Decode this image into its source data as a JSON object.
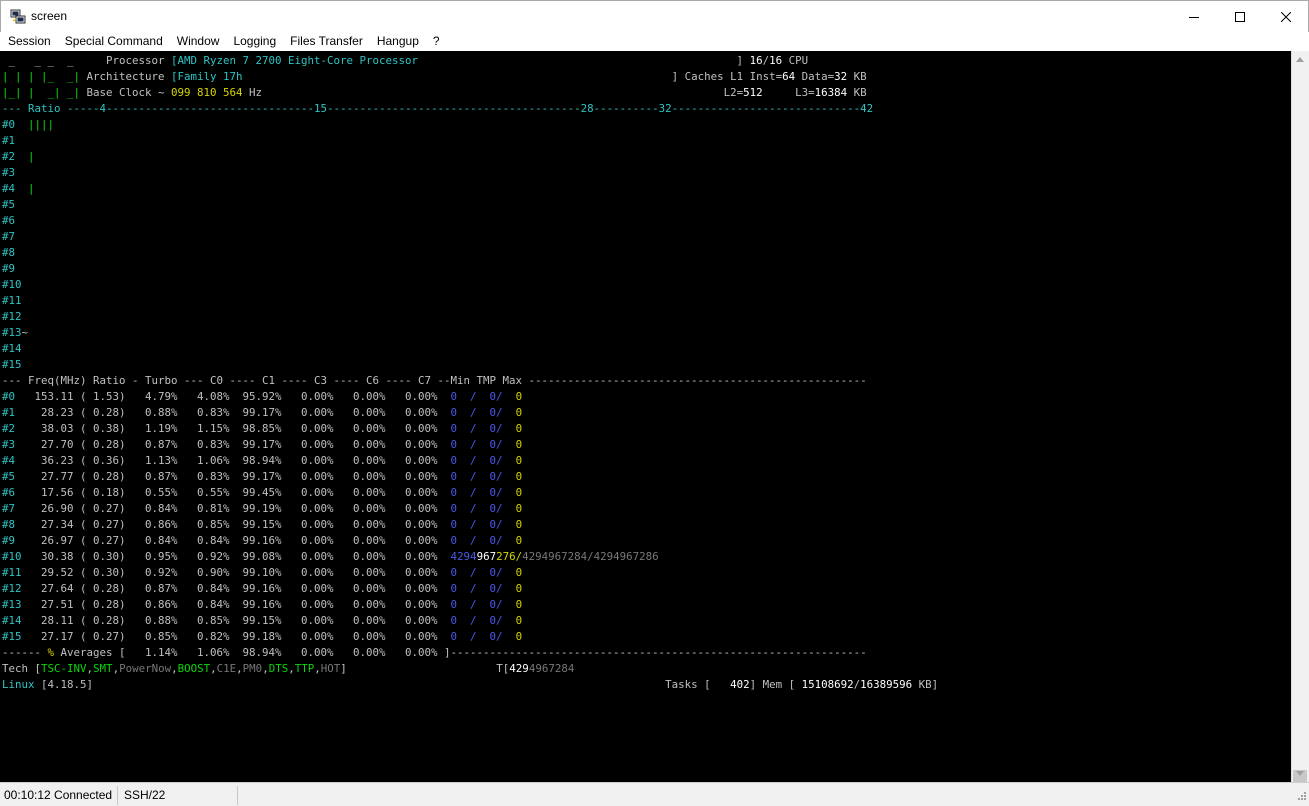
{
  "window": {
    "title": "screen"
  },
  "menu": [
    "Session",
    "Special Command",
    "Window",
    "Logging",
    "Files Transfer",
    "Hangup",
    "?"
  ],
  "terminal": {
    "lines": [
      [
        [
          "w",
          " _   _ _  _     Processor "
        ],
        [
          "cy",
          "["
        ],
        [
          "cy",
          "AMD Ryzen 7 2700 Eight-Core Processor"
        ],
        [
          "w",
          "                                                 ] "
        ],
        [
          "bw",
          "16"
        ],
        [
          "w",
          "/"
        ],
        [
          "bw",
          "16"
        ],
        [
          "w",
          " CPU"
        ]
      ],
      [
        [
          "gr",
          "| | | |_  _|"
        ],
        [
          "w",
          " Architecture "
        ],
        [
          "cy",
          "["
        ],
        [
          "cy",
          "Family 17h"
        ],
        [
          "w",
          "                                                                  ] Caches L1 Inst="
        ],
        [
          "bw",
          "64"
        ],
        [
          "w",
          " Data="
        ],
        [
          "bw",
          "32"
        ],
        [
          "w",
          " KB"
        ]
      ],
      [
        [
          "gr",
          "|_| |  _| _|"
        ],
        [
          "w",
          " Base Clock ~ "
        ],
        [
          "yl",
          "099 810 564"
        ],
        [
          "w",
          " Hz                                                                       L2="
        ],
        [
          "bw",
          "512"
        ],
        [
          "w",
          "     L3="
        ],
        [
          "bw",
          "16384"
        ],
        [
          "w",
          " KB"
        ]
      ],
      [
        [
          "cy",
          "--- Ratio -----"
        ],
        [
          "cy",
          "4"
        ],
        [
          "cy",
          "--------------------------------"
        ],
        [
          "cy",
          "15"
        ],
        [
          "cy",
          "---------------------------------------"
        ],
        [
          "cy",
          "28"
        ],
        [
          "cy",
          "----------"
        ],
        [
          "cy",
          "32"
        ],
        [
          "cy",
          "-----------------------------"
        ],
        [
          "cy",
          "42"
        ]
      ],
      [
        [
          "cy",
          "#0  "
        ],
        [
          "gr",
          "||||"
        ]
      ],
      [
        [
          "cy",
          "#1"
        ]
      ],
      [
        [
          "cy",
          "#2  "
        ],
        [
          "gr",
          "|"
        ]
      ],
      [
        [
          "cy",
          "#3"
        ]
      ],
      [
        [
          "cy",
          "#4  "
        ],
        [
          "gr",
          "|"
        ]
      ],
      [
        [
          "cy",
          "#5"
        ]
      ],
      [
        [
          "cy",
          "#6"
        ]
      ],
      [
        [
          "cy",
          "#7"
        ]
      ],
      [
        [
          "cy",
          "#8"
        ]
      ],
      [
        [
          "cy",
          "#9"
        ]
      ],
      [
        [
          "cy",
          "#10"
        ]
      ],
      [
        [
          "cy",
          "#11"
        ]
      ],
      [
        [
          "cy",
          "#12"
        ]
      ],
      [
        [
          "cy",
          "#13"
        ],
        [
          "w",
          "~"
        ]
      ],
      [
        [
          "cy",
          "#14"
        ]
      ],
      [
        [
          "cy",
          "#15"
        ]
      ],
      [
        [
          "w",
          "--- Freq"
        ],
        [
          "w",
          "(MHz)"
        ],
        [
          "w",
          " Ratio - Turbo --- C0 ---- C1 ---- C3 ---- C6 ---- C7 --Min TMP Max ----------------------------------------------------"
        ]
      ],
      [
        [
          "cy",
          "#0 "
        ],
        [
          "w",
          "  153.11 ( 1.53)   4.79%   4.08%  95.92%   0.00%   0.00%   0.00%  "
        ],
        [
          "bl",
          "0  /  0/  "
        ],
        [
          "yl",
          "0"
        ]
      ],
      [
        [
          "cy",
          "#1 "
        ],
        [
          "w",
          "   28.23 ( 0.28)   0.88%   0.83%  99.17%   0.00%   0.00%   0.00%  "
        ],
        [
          "bl",
          "0  /  0/  "
        ],
        [
          "yl",
          "0"
        ]
      ],
      [
        [
          "cy",
          "#2 "
        ],
        [
          "w",
          "   38.03 ( 0.38)   1.19%   1.15%  98.85%   0.00%   0.00%   0.00%  "
        ],
        [
          "bl",
          "0  /  0/  "
        ],
        [
          "yl",
          "0"
        ]
      ],
      [
        [
          "cy",
          "#3 "
        ],
        [
          "w",
          "   27.70 ( 0.28)   0.87%   0.83%  99.17%   0.00%   0.00%   0.00%  "
        ],
        [
          "bl",
          "0  /  0/  "
        ],
        [
          "yl",
          "0"
        ]
      ],
      [
        [
          "cy",
          "#4 "
        ],
        [
          "w",
          "   36.23 ( 0.36)   1.13%   1.06%  98.94%   0.00%   0.00%   0.00%  "
        ],
        [
          "bl",
          "0  /  0/  "
        ],
        [
          "yl",
          "0"
        ]
      ],
      [
        [
          "cy",
          "#5 "
        ],
        [
          "w",
          "   27.77 ( 0.28)   0.87%   0.83%  99.17%   0.00%   0.00%   0.00%  "
        ],
        [
          "bl",
          "0  /  0/  "
        ],
        [
          "yl",
          "0"
        ]
      ],
      [
        [
          "cy",
          "#6 "
        ],
        [
          "w",
          "   17.56 ( 0.18)   0.55%   0.55%  99.45%   0.00%   0.00%   0.00%  "
        ],
        [
          "bl",
          "0  /  0/  "
        ],
        [
          "yl",
          "0"
        ]
      ],
      [
        [
          "cy",
          "#7 "
        ],
        [
          "w",
          "   26.90 ( 0.27)   0.84%   0.81%  99.19%   0.00%   0.00%   0.00%  "
        ],
        [
          "bl",
          "0  /  0/  "
        ],
        [
          "yl",
          "0"
        ]
      ],
      [
        [
          "cy",
          "#8 "
        ],
        [
          "w",
          "   27.34 ( 0.27)   0.86%   0.85%  99.15%   0.00%   0.00%   0.00%  "
        ],
        [
          "bl",
          "0  /  0/  "
        ],
        [
          "yl",
          "0"
        ]
      ],
      [
        [
          "cy",
          "#9 "
        ],
        [
          "w",
          "   26.97 ( 0.27)   0.84%   0.84%  99.16%   0.00%   0.00%   0.00%  "
        ],
        [
          "bl",
          "0  /  0/  "
        ],
        [
          "yl",
          "0"
        ]
      ],
      [
        [
          "cy",
          "#10"
        ],
        [
          "w",
          "   30.38 ( 0.30)   0.95%   0.92%  99.08%   0.00%   0.00%   0.00%  "
        ],
        [
          "bl",
          "4294"
        ],
        [
          "bw",
          "967"
        ],
        [
          "yl",
          "276/"
        ],
        [
          "dg",
          "4294967284/4294967286"
        ]
      ],
      [
        [
          "cy",
          "#11"
        ],
        [
          "w",
          "   29.52 ( 0.30)   0.92%   0.90%  99.10%   0.00%   0.00%   0.00%  "
        ],
        [
          "bl",
          "0  /  0/  "
        ],
        [
          "yl",
          "0"
        ]
      ],
      [
        [
          "cy",
          "#12"
        ],
        [
          "w",
          "   27.64 ( 0.28)   0.87%   0.84%  99.16%   0.00%   0.00%   0.00%  "
        ],
        [
          "bl",
          "0  /  0/  "
        ],
        [
          "yl",
          "0"
        ]
      ],
      [
        [
          "cy",
          "#13"
        ],
        [
          "w",
          "   27.51 ( 0.28)   0.86%   0.84%  99.16%   0.00%   0.00%   0.00%  "
        ],
        [
          "bl",
          "0  /  0/  "
        ],
        [
          "yl",
          "0"
        ]
      ],
      [
        [
          "cy",
          "#14"
        ],
        [
          "w",
          "   28.11 ( 0.28)   0.88%   0.85%  99.15%   0.00%   0.00%   0.00%  "
        ],
        [
          "bl",
          "0  /  0/  "
        ],
        [
          "yl",
          "0"
        ]
      ],
      [
        [
          "cy",
          "#15"
        ],
        [
          "w",
          "   27.17 ( 0.27)   0.85%   0.82%  99.18%   0.00%   0.00%   0.00%  "
        ],
        [
          "bl",
          "0  /  0/  "
        ],
        [
          "yl",
          "0"
        ]
      ],
      [
        [
          "w",
          "------ "
        ],
        [
          "yl",
          "%"
        ],
        [
          "w",
          " Averages [   1.14%   1.06%  98.94%   0.00%   0.00%   0.00% ]----------------------------------------------------------------"
        ]
      ],
      [
        [
          "w",
          "Tech ["
        ],
        [
          "gr",
          "TSC-INV"
        ],
        [
          "w",
          ","
        ],
        [
          "gr",
          "SMT"
        ],
        [
          "w",
          ","
        ],
        [
          "dg",
          "PowerNow"
        ],
        [
          "w",
          ","
        ],
        [
          "gr",
          "BOOST"
        ],
        [
          "w",
          ","
        ],
        [
          "dg",
          "C1E"
        ],
        [
          "w",
          ","
        ],
        [
          "dg",
          "PM0"
        ],
        [
          "w",
          ","
        ],
        [
          "gr",
          "DTS"
        ],
        [
          "w",
          ","
        ],
        [
          "gr",
          "TTP"
        ],
        [
          "w",
          ","
        ],
        [
          "dg",
          "HOT"
        ],
        [
          "w",
          "]                       T["
        ],
        [
          "bw",
          "429"
        ],
        [
          "dg",
          "4967284"
        ]
      ],
      [
        [
          "cy",
          "Linux"
        ],
        [
          "w",
          " ["
        ],
        [
          "w",
          "4.18.5"
        ],
        [
          "w",
          "]                                                                                        Tasks [   "
        ],
        [
          "bw",
          "402"
        ],
        [
          "w",
          "] Mem [ "
        ],
        [
          "bw",
          "15108692"
        ],
        [
          "w",
          "/"
        ],
        [
          "bw",
          "16389596"
        ],
        [
          "w",
          " KB]"
        ]
      ]
    ]
  },
  "status": {
    "connection": "00:10:12 Connected",
    "protocol": "SSH/22"
  }
}
